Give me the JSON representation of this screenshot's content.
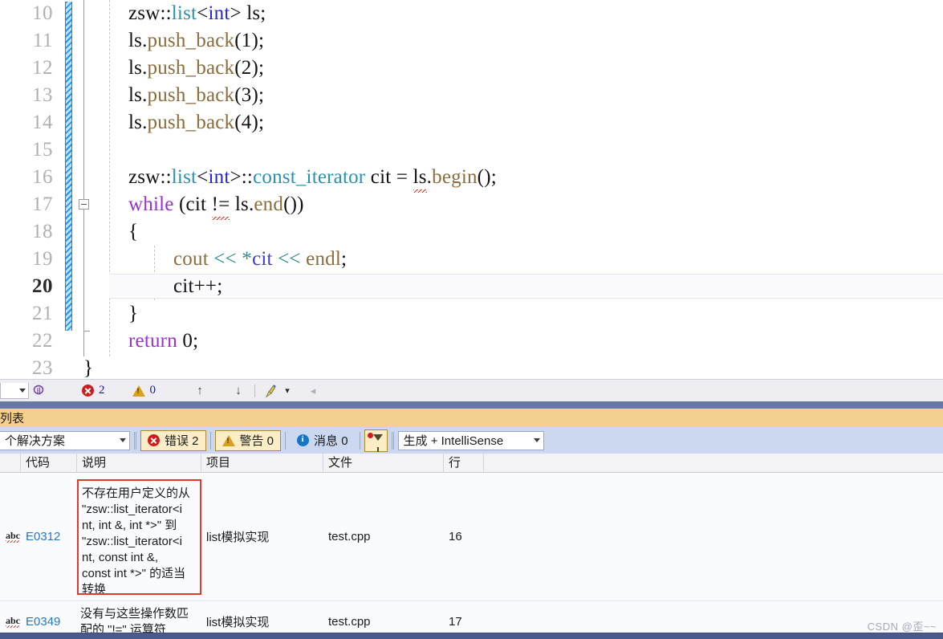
{
  "editor": {
    "first_line_number": 10,
    "current_line": 20,
    "lines": [
      {
        "n": "10",
        "text": "zsw::list<int> ls;"
      },
      {
        "n": "11",
        "text": "ls.push_back(1);"
      },
      {
        "n": "12",
        "text": "ls.push_back(2);"
      },
      {
        "n": "13",
        "text": "ls.push_back(3);"
      },
      {
        "n": "14",
        "text": "ls.push_back(4);"
      },
      {
        "n": "15",
        "text": ""
      },
      {
        "n": "16",
        "text": "zsw::list<int>::const_iterator cit = ls.begin();"
      },
      {
        "n": "17",
        "text": "while (cit != ls.end())"
      },
      {
        "n": "18",
        "text": "{"
      },
      {
        "n": "19",
        "text": "cout << *cit << endl;"
      },
      {
        "n": "20",
        "text": "cit++;"
      },
      {
        "n": "21",
        "text": "}"
      },
      {
        "n": "22",
        "text": "return 0;"
      },
      {
        "n": "23",
        "text": "}"
      }
    ],
    "tokens": {
      "ns": "zsw",
      "scope": "::",
      "type_list": "list",
      "kw_int": "int",
      "type_const_iterator": "const_iterator",
      "var_ls": "ls",
      "var_cit": "cit",
      "fn_push_back": "push_back",
      "fn_begin": "begin",
      "fn_end": "end",
      "kw_while": "while",
      "kw_return": "return",
      "io_cout": "cout",
      "io_endl": "endl",
      "op_shift": "<<",
      "op_neq": "!=",
      "op_inc": "++",
      "num_0": "0",
      "num_1": "1",
      "num_2": "2",
      "num_3": "3",
      "num_4": "4"
    }
  },
  "nav_strip": {
    "error_count": "2",
    "warning_count": "0",
    "prev_label": "↑",
    "next_label": "↓",
    "clean_label": "✦",
    "caret_label": "▾",
    "collapse_left": "◂"
  },
  "panel": {
    "title": "列表",
    "scope_selected": "个解决方案",
    "errors_label": "错误 2",
    "warnings_label": "警告 0",
    "messages_label": "消息 0",
    "build_selected": "生成 + IntelliSense"
  },
  "grid": {
    "columns": [
      "",
      "代码",
      "说明",
      "项目",
      "文件",
      "行",
      ""
    ],
    "rows": [
      {
        "icon": "abc",
        "code": "E0312",
        "description": "不存在用户定义的从\n\"zsw::list_iterator<i\nnt, int &, int *>\" 到\n\"zsw::list_iterator<i\nnt, const int &,\nconst int *>\" 的适当\n转换",
        "project": "list模拟实现",
        "file": "test.cpp",
        "line": "16"
      },
      {
        "icon": "abc",
        "code": "E0349",
        "description": "没有与这些操作数匹\n配的 \"!=\" 运算符",
        "project": "list模拟实现",
        "file": "test.cpp",
        "line": "17"
      }
    ]
  },
  "watermark": {
    "text": "CSDN @歪~~"
  },
  "colors": {
    "accent_blue": "#2678c4",
    "error_red": "#cf1b1b",
    "warning_amber": "#d8a01c",
    "info_blue": "#1576c4",
    "panel_title_bg": "#f5cf8e",
    "filter_bar_bg": "#ccd8ef",
    "divider": "#68789e"
  }
}
